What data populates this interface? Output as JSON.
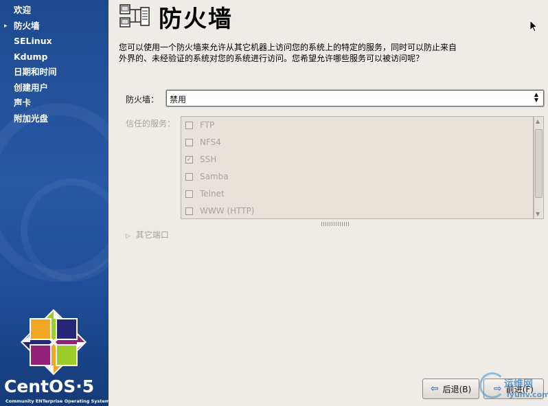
{
  "sidebar": {
    "steps": [
      {
        "label": "欢迎",
        "current": false
      },
      {
        "label": "防火墙",
        "current": true
      },
      {
        "label": "SELinux",
        "current": false
      },
      {
        "label": "Kdump",
        "current": false
      },
      {
        "label": "日期和时间",
        "current": false
      },
      {
        "label": "创建用户",
        "current": false
      },
      {
        "label": "声卡",
        "current": false
      },
      {
        "label": "附加光盘",
        "current": false
      }
    ],
    "current_marker": "▸",
    "brand": {
      "name": "CentOS·5",
      "tagline": "Community ENTerprise Operating System"
    }
  },
  "header": {
    "title": "防火墙",
    "icon": "firewall-icon"
  },
  "main": {
    "description": "您可以使用一个防火墙来允许从其它机器上访问您的系统上的特定的服务，同时可以防止来自外界的、未经验证的系统对您的系统进行访问。您希望允许哪些服务可以被访问呢？",
    "firewall": {
      "label": "防火墙：",
      "value": "禁用"
    },
    "trusted_services": {
      "label": "信任的服务：",
      "items": [
        {
          "name": "FTP",
          "checked": false
        },
        {
          "name": "NFS4",
          "checked": false
        },
        {
          "name": "SSH",
          "checked": true
        },
        {
          "name": "Samba",
          "checked": false
        },
        {
          "name": "Telnet",
          "checked": false
        },
        {
          "name": "WWW (HTTP)",
          "checked": false
        }
      ]
    },
    "other_ports": {
      "label": "其它端口"
    }
  },
  "buttons": {
    "back": "后退(B)",
    "next": "前进(F)"
  },
  "watermark": {
    "line1": "运维网",
    "line2": "iyunv.com"
  },
  "colors": {
    "sidebar_blue": "#2759a4",
    "background": "#efebe7",
    "disabled_text": "#a8a39c"
  }
}
